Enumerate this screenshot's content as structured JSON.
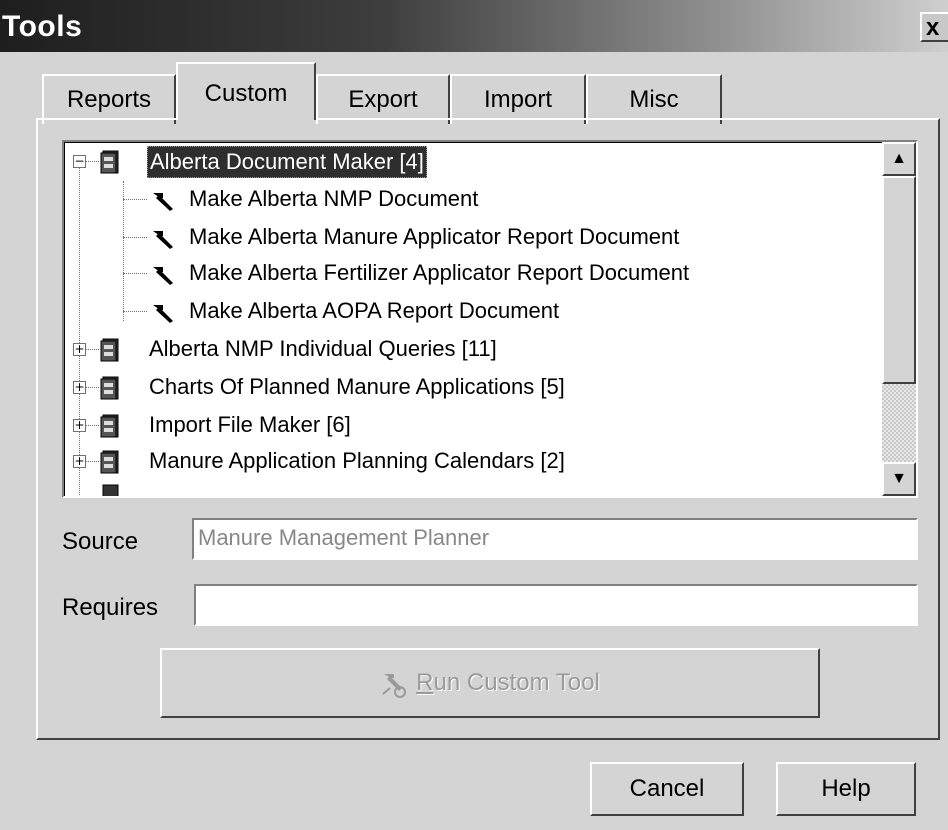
{
  "window": {
    "title": "Tools",
    "close_label": "x"
  },
  "tabs": [
    {
      "label": "Reports",
      "selected": false
    },
    {
      "label": "Custom",
      "selected": true
    },
    {
      "label": "Export",
      "selected": false
    },
    {
      "label": "Import",
      "selected": false
    },
    {
      "label": "Misc",
      "selected": false
    }
  ],
  "tree": {
    "groups": [
      {
        "label": "Alberta Document Maker  [4]",
        "expanded": true,
        "selected": true,
        "icon": "cabinet-icon",
        "children": [
          {
            "label": "Make Alberta NMP Document",
            "icon": "hammer-icon"
          },
          {
            "label": "Make Alberta Manure Applicator Report Document",
            "icon": "hammer-icon"
          },
          {
            "label": "Make Alberta Fertilizer Applicator Report Document",
            "icon": "hammer-icon"
          },
          {
            "label": "Make Alberta AOPA Report Document",
            "icon": "hammer-icon"
          }
        ]
      },
      {
        "label": "Alberta NMP Individual Queries  [11]",
        "expanded": false,
        "icon": "cabinet-icon"
      },
      {
        "label": "Charts Of Planned Manure Applications  [5]",
        "expanded": false,
        "icon": "cabinet-icon"
      },
      {
        "label": "Import File Maker  [6]",
        "expanded": false,
        "icon": "cabinet-icon"
      },
      {
        "label": "Manure Application Planning Calendars  [2]",
        "expanded": false,
        "icon": "cabinet-icon"
      }
    ],
    "expanded_symbol": "−",
    "collapsed_symbol": "+"
  },
  "source": {
    "label": "Source",
    "value": "Manure Management Planner"
  },
  "requires": {
    "label": "Requires",
    "value": ""
  },
  "run_button": {
    "mnemonic": "R",
    "rest": "un Custom Tool",
    "enabled": false,
    "icon": "run-tool-icon"
  },
  "footer": {
    "cancel_label": "Cancel",
    "help_label": "Help"
  },
  "scrollbar": {
    "up_symbol": "▲",
    "down_symbol": "▼"
  }
}
